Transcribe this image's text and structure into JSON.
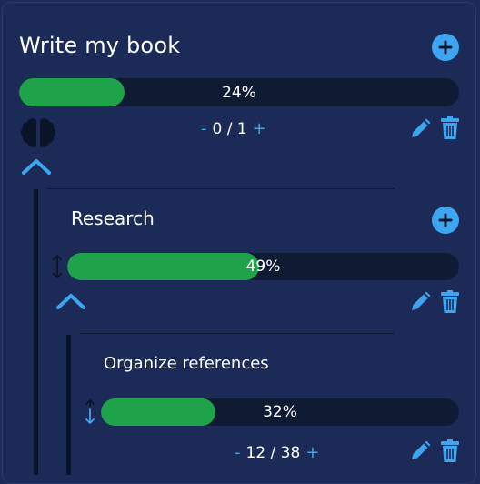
{
  "colors": {
    "accent": "#3ea5f0",
    "progress": "#1fa34a",
    "track": "#0f1a33",
    "background": "#1b2a57"
  },
  "goal": {
    "title": "Write my book",
    "progress_label": "24%",
    "progress": 0.24,
    "counter_value": "0 / 1",
    "counter_minus": "-",
    "counter_plus": "+"
  },
  "subgoal": {
    "title": "Research",
    "progress_label": "49%",
    "progress": 0.49
  },
  "subsubgoal": {
    "title": "Organize references",
    "progress_label": "32%",
    "progress": 0.32,
    "counter_value": "12 / 38",
    "counter_minus": "-",
    "counter_plus": "+"
  }
}
